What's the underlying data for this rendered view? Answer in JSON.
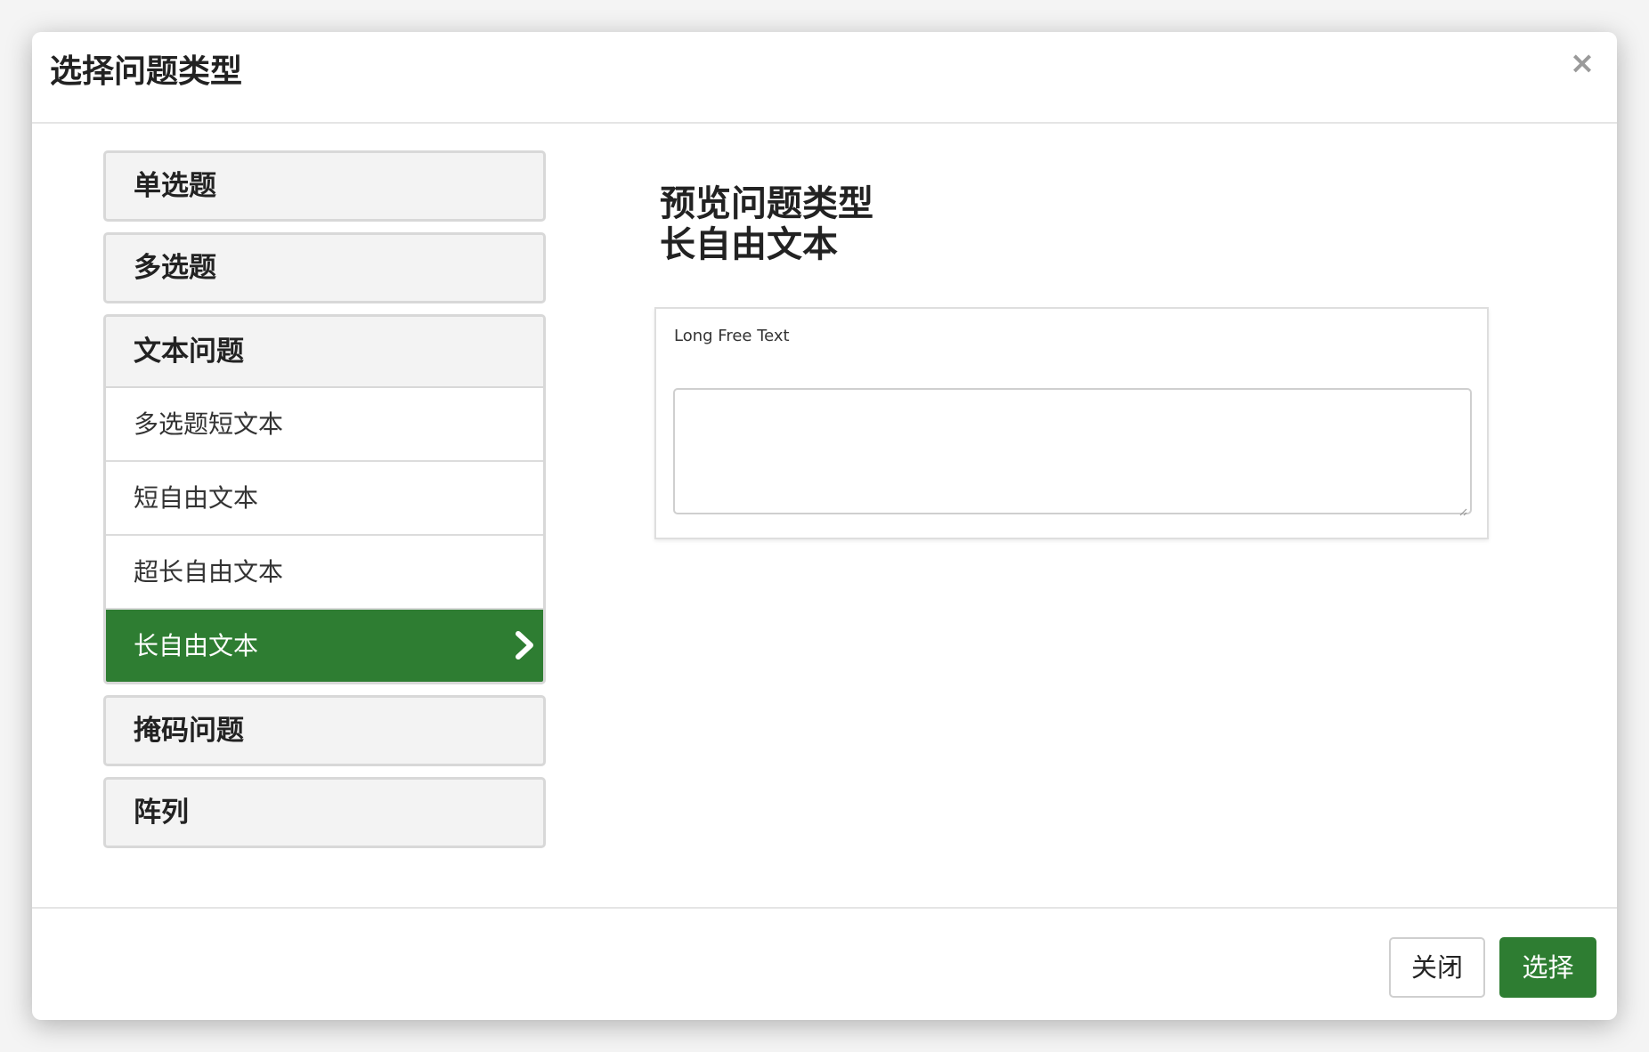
{
  "dialog": {
    "title": "选择问题类型",
    "close_icon": "close-icon"
  },
  "question_types": {
    "single_choice": "单选题",
    "multiple_choice": "多选题",
    "text_group": {
      "label": "文本问题",
      "items": [
        {
          "label": "多选题短文本",
          "active": false
        },
        {
          "label": "短自由文本",
          "active": false
        },
        {
          "label": "超长自由文本",
          "active": false
        },
        {
          "label": "长自由文本",
          "active": true,
          "icon": "chevron-right-icon"
        }
      ]
    },
    "mask_questions": "掩码问题",
    "array": "阵列"
  },
  "preview": {
    "heading": "预览问题类型",
    "type_name": "长自由文本",
    "sample_label": "Long Free Text",
    "textarea_value": ""
  },
  "footer": {
    "close_label": "关闭",
    "select_label": "选择"
  },
  "colors": {
    "accent": "#2e7d32",
    "group_bg": "#f3f3f3",
    "border": "#d8d8d8"
  }
}
